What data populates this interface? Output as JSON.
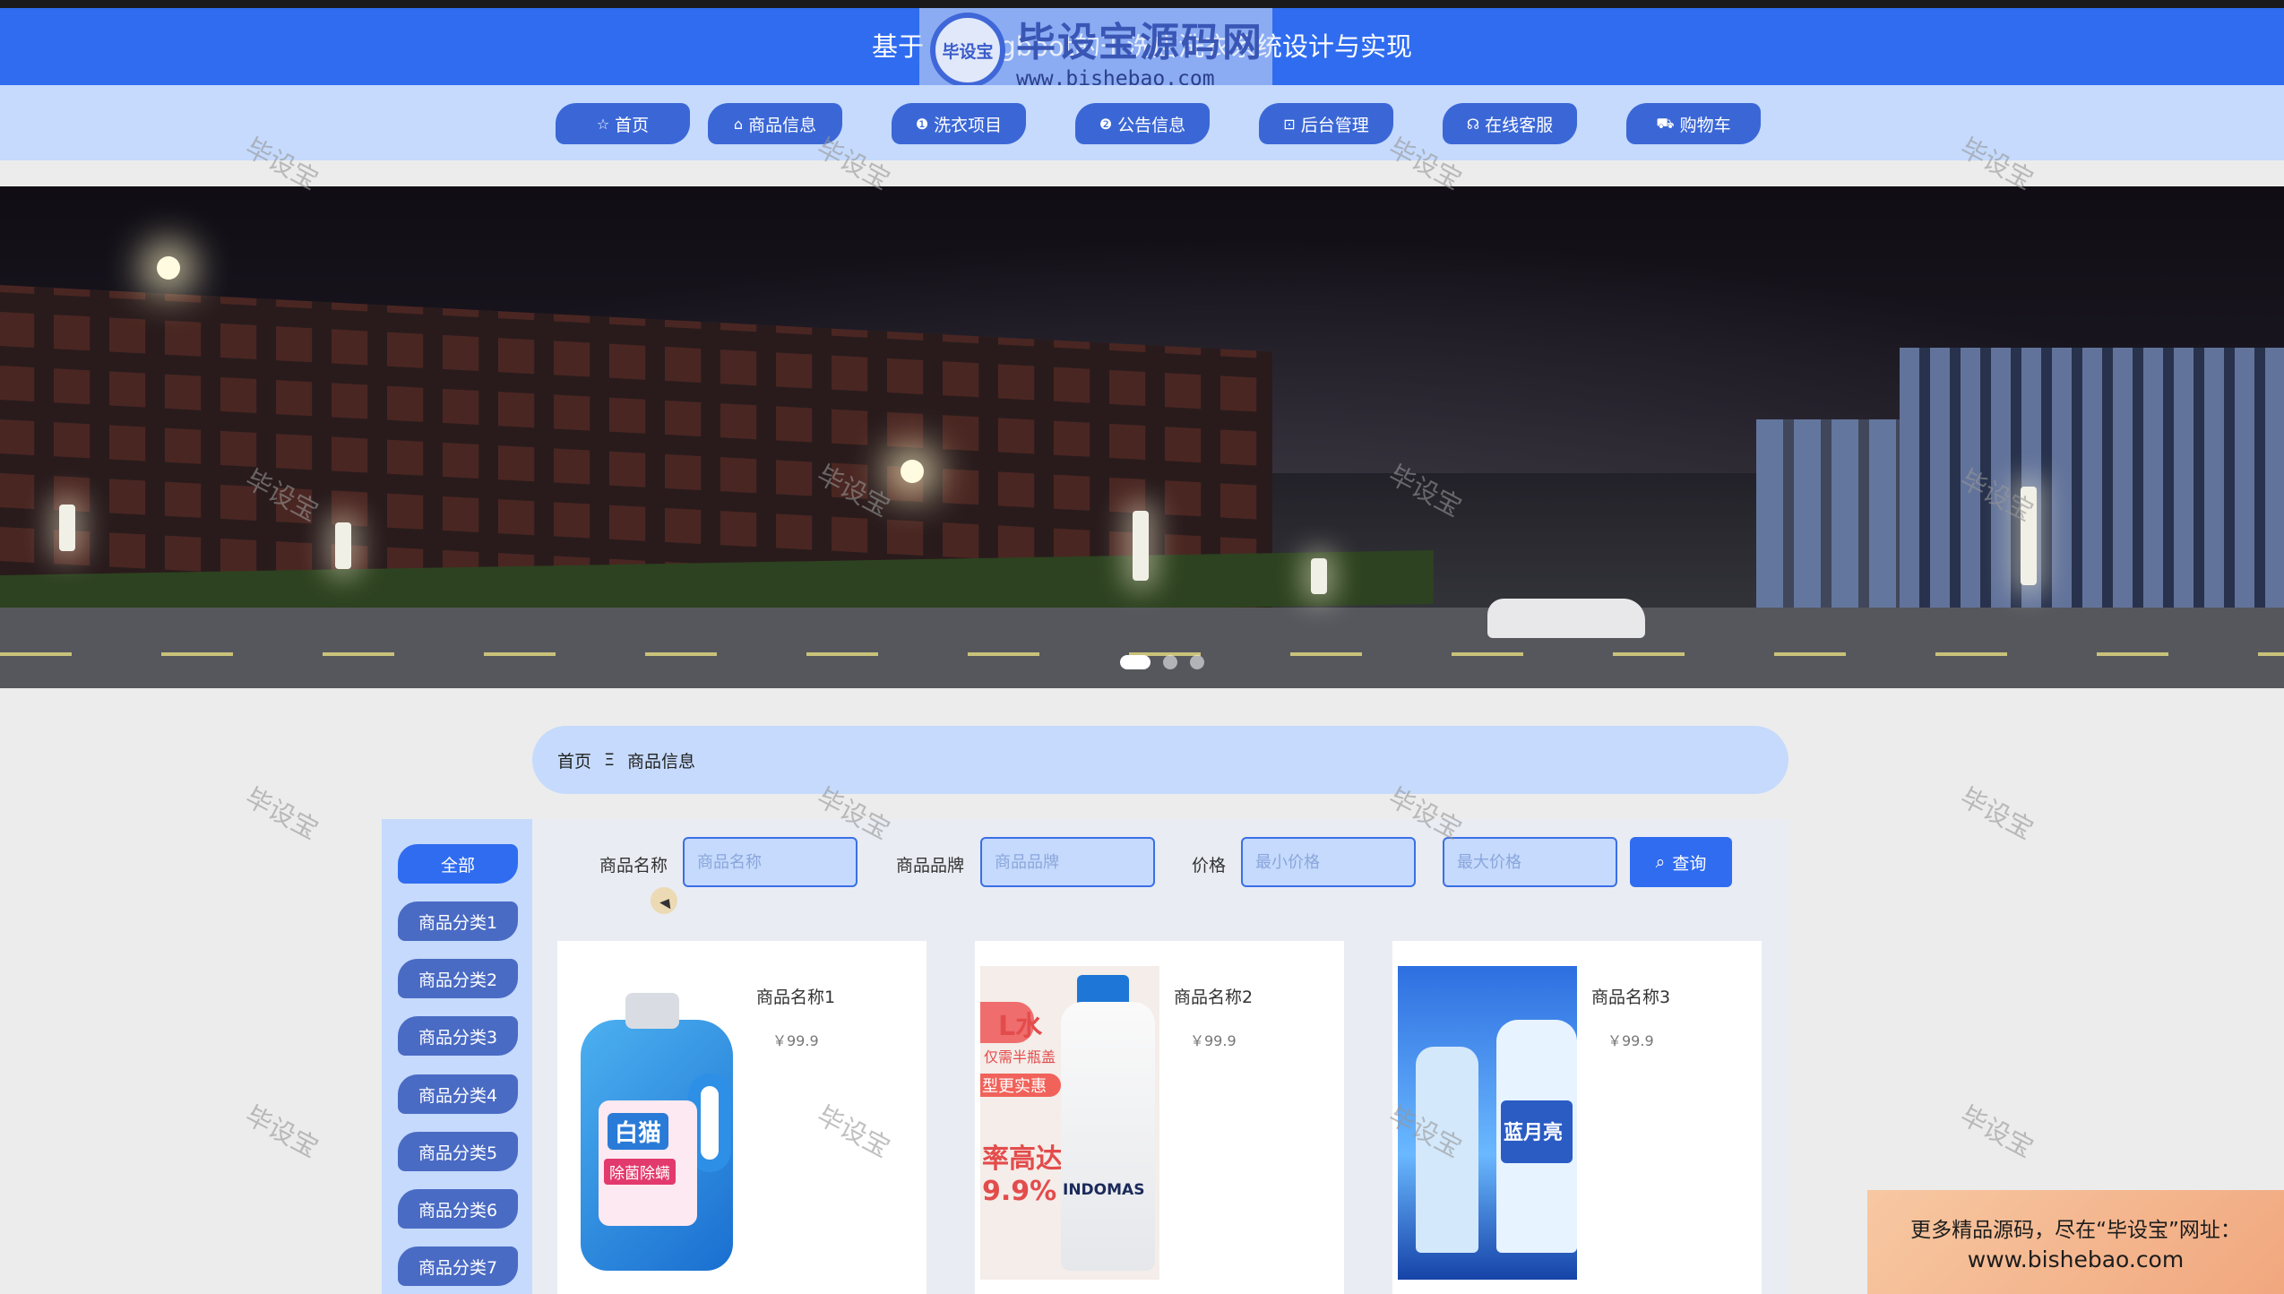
{
  "header": {
    "title": "基于 Springboot的干洗店洗衣系统设计与实现",
    "logo_seal": "毕设宝",
    "logo_cn": "毕设宝源码网",
    "logo_url": "www.bishebao.com"
  },
  "nav": [
    {
      "icon": "☆",
      "label": "首页"
    },
    {
      "icon": "⌂",
      "label": "商品信息"
    },
    {
      "icon": "❶",
      "label": "洗衣项目"
    },
    {
      "icon": "❷",
      "label": "公告信息"
    },
    {
      "icon": "⊡",
      "label": "后台管理"
    },
    {
      "icon": "☊",
      "label": "在线客服"
    },
    {
      "icon": "⛟",
      "label": "购物车"
    }
  ],
  "breadcrumb": {
    "home": "首页",
    "separator": "Ξ",
    "current": "商品信息"
  },
  "categories": [
    "全部",
    "商品分类1",
    "商品分类2",
    "商品分类3",
    "商品分类4",
    "商品分类5",
    "商品分类6",
    "商品分类7"
  ],
  "search": {
    "name_label": "商品名称",
    "name_placeholder": "商品名称",
    "brand_label": "商品品牌",
    "brand_placeholder": "商品品牌",
    "price_label": "价格",
    "min_placeholder": "最小价格",
    "max_placeholder": "最大价格",
    "button_label": "查询"
  },
  "products": [
    {
      "name": "商品名称1",
      "price": "￥99.9"
    },
    {
      "name": "商品名称2",
      "price": "￥99.9"
    },
    {
      "name": "商品名称3",
      "price": "￥99.9"
    }
  ],
  "product_image_text": {
    "img1_brand": "白猫",
    "img1_tag": "除菌除螨",
    "img2_title": "L水",
    "img2_sub": "仅需半瓶盖",
    "img2_tag": "型更实惠",
    "img2_big": "率高达",
    "img2_pct": "9.9%",
    "img2_brand": "INDOMAS",
    "img3_brand": "蓝月亮"
  },
  "watermark": "毕设宝",
  "promo": {
    "line1": "更多精品源码，尽在“毕设宝”网址：",
    "line2": "www.bishebao.com"
  },
  "colors": {
    "primary": "#2f6cf0",
    "nav_bg": "#c5dafc",
    "nav_item": "#3b67d6",
    "page_bg": "#ececec"
  }
}
